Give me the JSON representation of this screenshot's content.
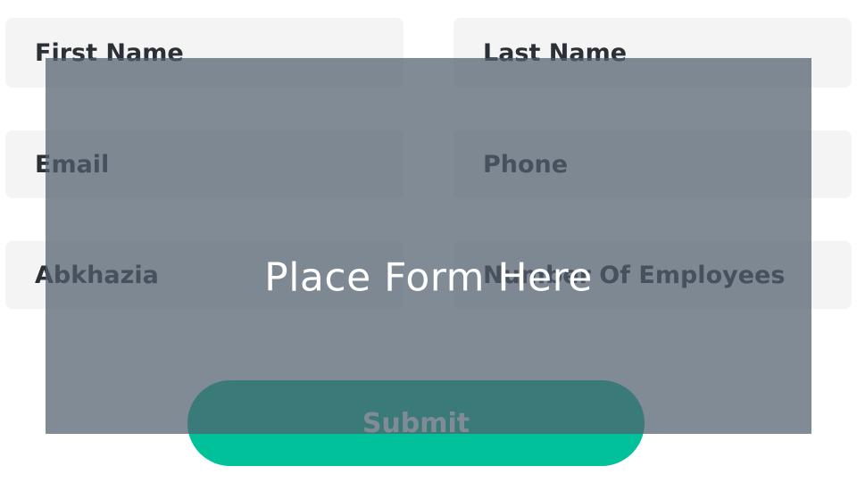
{
  "form": {
    "first_name_placeholder": "First Name",
    "last_name_placeholder": "Last Name",
    "email_placeholder": "Email",
    "phone_placeholder": "Phone",
    "country_value": "Abkhazia",
    "employees_placeholder": "Number Of Employees",
    "submit_label": "Submit"
  },
  "overlay": {
    "label": "Place Form Here"
  },
  "colors": {
    "field_bg": "#f4f4f4",
    "accent": "#00c19a",
    "overlay": "#515e6c",
    "text": "#2b2f36"
  }
}
